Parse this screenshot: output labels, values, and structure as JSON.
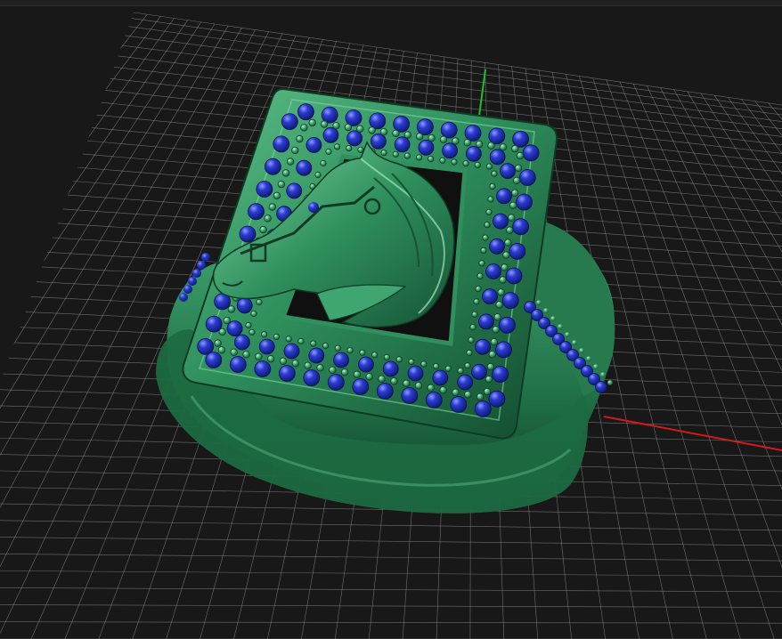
{
  "viewport": {
    "background": "#181818",
    "grid_color": "#8a8a8a",
    "x_axis_color": "#d31a1a",
    "y_axis_color": "#1fbf2a"
  },
  "model": {
    "metal_color": "#2f8f5d",
    "metal_dark": "#155a36",
    "metal_light": "#7fd8a7",
    "gem_color": "#1a2aa8",
    "gem_highlight": "#8e9bff",
    "icon": "horse-head-signet-ring"
  }
}
